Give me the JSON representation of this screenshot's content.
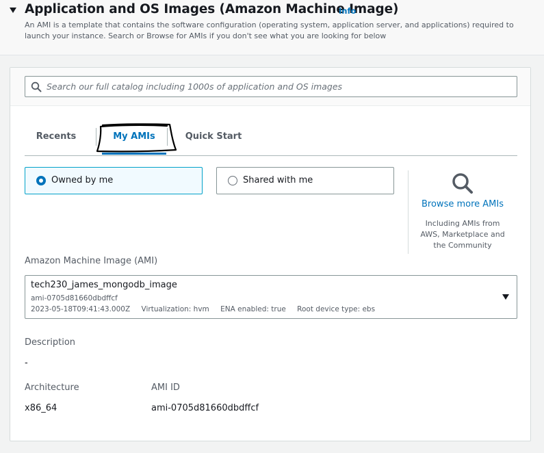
{
  "header": {
    "title": "Application and OS Images (Amazon Machine Image)",
    "info_link": "Info",
    "description": "An AMI is a template that contains the software configuration (operating system, application server, and applications) required to launch your instance. Search or Browse for AMIs if you don't see what you are looking for below"
  },
  "search": {
    "placeholder": "Search our full catalog including 1000s of application and OS images",
    "value": ""
  },
  "tabs": [
    {
      "label": "Recents",
      "active": false
    },
    {
      "label": "My AMIs",
      "active": true
    },
    {
      "label": "Quick Start",
      "active": false
    }
  ],
  "ownership": {
    "options": [
      {
        "label": "Owned by me",
        "selected": true
      },
      {
        "label": "Shared with me",
        "selected": false
      }
    ]
  },
  "browse": {
    "icon": "search-icon",
    "link": "Browse more AMIs",
    "subtext": "Including AMIs from AWS, Marketplace and the Community"
  },
  "ami_select": {
    "label": "Amazon Machine Image (AMI)",
    "name": "tech230_james_mongodb_image",
    "id": "ami-0705d81660dbdffcf",
    "date": "2023-05-18T09:41:43.000Z",
    "virtualization": "Virtualization: hvm",
    "ena": "ENA enabled: true",
    "root_device": "Root device type: ebs"
  },
  "details": {
    "description_label": "Description",
    "description_value": "-",
    "architecture_label": "Architecture",
    "architecture_value": "x86_64",
    "ami_id_label": "AMI ID",
    "ami_id_value": "ami-0705d81660dbdffcf"
  },
  "colors": {
    "link": "#0073bb",
    "selected_border": "#00a1c9",
    "selected_bg": "#f1faff"
  }
}
